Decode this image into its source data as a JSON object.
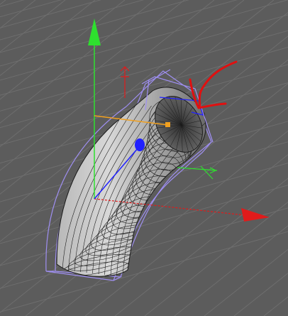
{
  "viewport": {
    "type": "3d-perspective-viewport",
    "background": "#5c5c5c",
    "grid_color": "#6e6e6e"
  },
  "object": {
    "kind": "bent-tube-mesh",
    "shade_color": "#4a4a4a",
    "wire_color": "#1d1d1d",
    "bounding_box_color": "#9f8ff2"
  },
  "gizmo": {
    "y_axis_color": "#2ee02e",
    "x_axis_color": "#e01b1b",
    "z_axis_color": "#2020ff",
    "handle_color": "#f0a020"
  },
  "annotation": {
    "color": "#e01010",
    "meaning": "hand-drawn-arrow-pointing-at-tube-opening"
  }
}
